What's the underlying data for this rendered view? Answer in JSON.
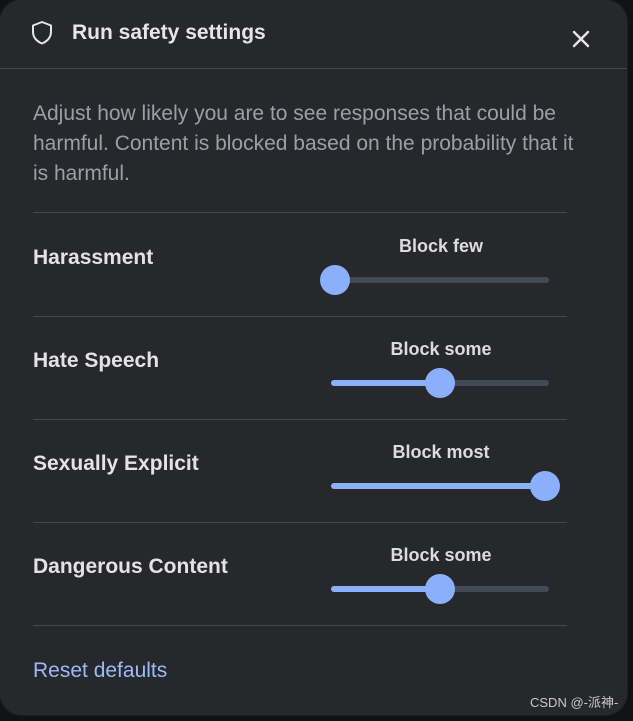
{
  "dialog": {
    "title": "Run safety settings",
    "title_icon": "shield-icon",
    "close_icon": "close-icon",
    "description": "Adjust how likely you are to see responses that could be harmful. Content is blocked based on the probability that it is harmful."
  },
  "settings": [
    {
      "label": "Harassment",
      "level": "Block few",
      "value_fraction": 0.0
    },
    {
      "label": "Hate Speech",
      "level": "Block some",
      "value_fraction": 0.5
    },
    {
      "label": "Sexually Explicit",
      "level": "Block most",
      "value_fraction": 1.0
    },
    {
      "label": "Dangerous Content",
      "level": "Block some",
      "value_fraction": 0.5
    }
  ],
  "footer": {
    "reset_label": "Reset defaults"
  },
  "watermark": "CSDN @-派神-",
  "colors": {
    "background": "#27282c",
    "accent": "#8ab0fb",
    "track": "#434955",
    "link": "#9db9f7",
    "divider": "#45474c"
  }
}
